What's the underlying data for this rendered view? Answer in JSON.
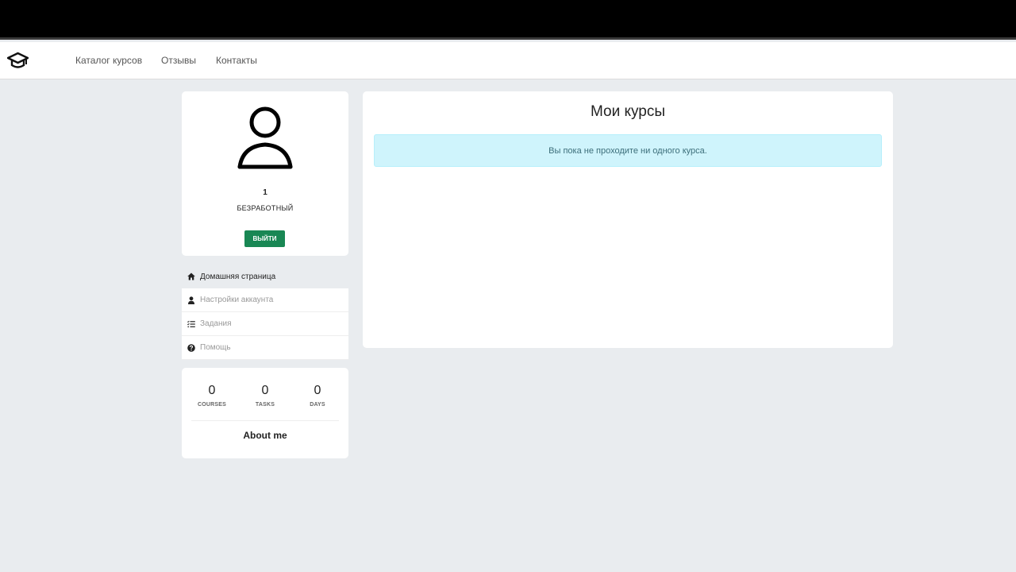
{
  "nav": {
    "links": [
      "Каталог курсов",
      "Отзывы",
      "Контакты"
    ]
  },
  "profile": {
    "id": "1",
    "status": "БЕЗРАБОТНЫЙ",
    "logout_label": "ВЫЙТИ"
  },
  "menu": {
    "items": [
      {
        "label": "Домашняя страница",
        "icon": "home-icon",
        "active": true
      },
      {
        "label": "Настройки аккаунта",
        "icon": "user-icon",
        "active": false
      },
      {
        "label": "Задания",
        "icon": "task-list-icon",
        "active": false
      },
      {
        "label": "Помощь",
        "icon": "help-icon",
        "active": false
      }
    ]
  },
  "stats": {
    "courses": {
      "value": "0",
      "label": "COURSES"
    },
    "tasks": {
      "value": "0",
      "label": "TASKS"
    },
    "days": {
      "value": "0",
      "label": "DAYS"
    },
    "about_title": "About me"
  },
  "main": {
    "title": "Мои курсы",
    "alert_text": "Вы пока не проходите ни одного курса."
  },
  "colors": {
    "accent_button": "#198754",
    "alert_bg": "#cff4fc",
    "page_bg": "#e9ecef"
  }
}
